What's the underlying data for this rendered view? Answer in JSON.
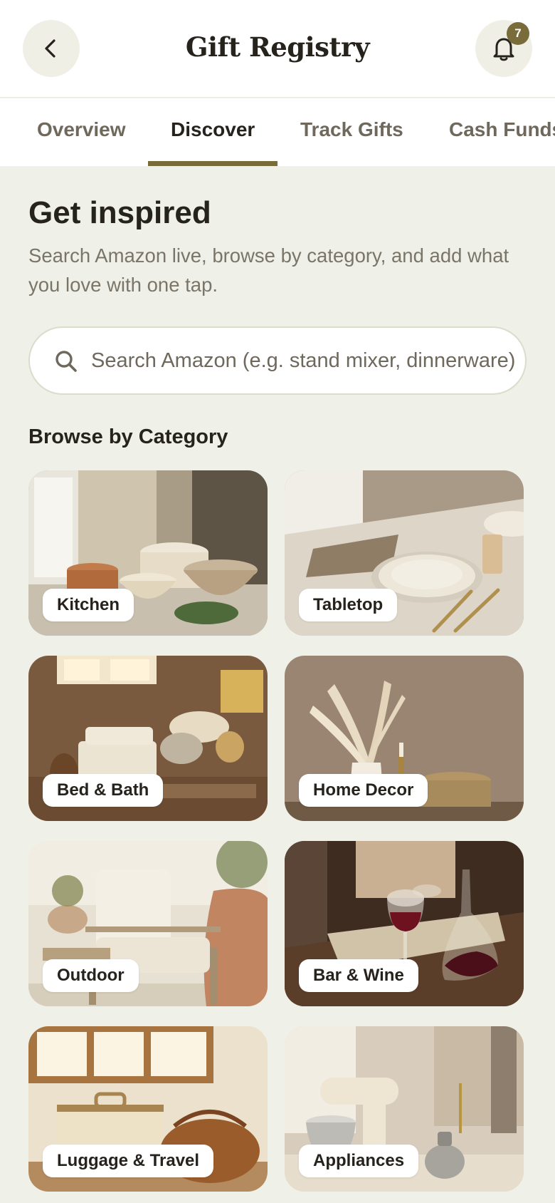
{
  "header": {
    "title": "Gift Registry",
    "notification_count": "7",
    "back_icon": "chevron-left-icon",
    "bell_icon": "bell-icon"
  },
  "tabs": [
    {
      "label": "Overview",
      "active": false
    },
    {
      "label": "Discover",
      "active": true
    },
    {
      "label": "Track Gifts",
      "active": false
    },
    {
      "label": "Cash Funds",
      "active": false
    }
  ],
  "intro": {
    "heading": "Get inspired",
    "subtitle": "Search Amazon live, browse by category, and add what you love with one tap."
  },
  "search": {
    "placeholder": "Search Amazon (e.g. stand mixer, dinnerware)",
    "value": "",
    "icon": "search-icon"
  },
  "categories": {
    "heading": "Browse by Category",
    "items": [
      {
        "label": "Kitchen"
      },
      {
        "label": "Tabletop"
      },
      {
        "label": "Bed & Bath"
      },
      {
        "label": "Home Decor"
      },
      {
        "label": "Outdoor"
      },
      {
        "label": "Bar & Wine"
      },
      {
        "label": "Luggage & Travel"
      },
      {
        "label": "Appliances"
      }
    ]
  },
  "colors": {
    "accent": "#7a6b3a",
    "background": "#eff0e7",
    "text": "#26231d",
    "muted": "#6e685d"
  }
}
